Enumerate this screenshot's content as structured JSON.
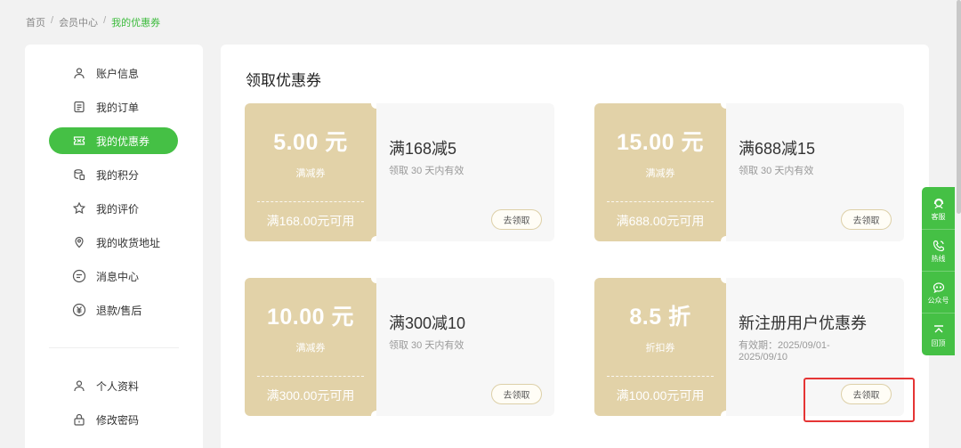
{
  "breadcrumb": {
    "home": "首页",
    "member": "会员中心",
    "current": "我的优惠券",
    "sep": "/"
  },
  "sidebar": {
    "items": [
      {
        "label": "账户信息",
        "icon": "user-icon"
      },
      {
        "label": "我的订单",
        "icon": "order-icon"
      },
      {
        "label": "我的优惠券",
        "icon": "coupon-icon",
        "active": true
      },
      {
        "label": "我的积分",
        "icon": "points-icon"
      },
      {
        "label": "我的评价",
        "icon": "review-icon"
      },
      {
        "label": "我的收货地址",
        "icon": "location-icon"
      },
      {
        "label": "消息中心",
        "icon": "message-icon"
      },
      {
        "label": "退款/售后",
        "icon": "refund-icon"
      },
      {
        "label": "个人资料",
        "icon": "profile-icon"
      },
      {
        "label": "修改密码",
        "icon": "lock-icon"
      }
    ]
  },
  "main": {
    "title": "领取优惠券",
    "coupons": [
      {
        "amount": "5.00 元",
        "kind": "满减券",
        "condition": "满168.00元可用",
        "name": "满168减5",
        "validity": "领取 30 天内有效",
        "button": "去领取"
      },
      {
        "amount": "15.00 元",
        "kind": "满减券",
        "condition": "满688.00元可用",
        "name": "满688减15",
        "validity": "领取 30 天内有效",
        "button": "去领取"
      },
      {
        "amount": "10.00 元",
        "kind": "满减券",
        "condition": "满300.00元可用",
        "name": "满300减10",
        "validity": "领取 30 天内有效",
        "button": "去领取"
      },
      {
        "amount": "8.5 折",
        "kind": "折扣券",
        "condition": "满100.00元可用",
        "name": "新注册用户优惠券",
        "validity": "有效期：2025/09/01-2025/09/10",
        "button": "去领取"
      }
    ]
  },
  "float_bar": {
    "items": [
      {
        "label": "客服",
        "icon": "customer-service-icon"
      },
      {
        "label": "热线",
        "icon": "phone-icon"
      },
      {
        "label": "公众号",
        "icon": "wechat-icon"
      },
      {
        "label": "回顶",
        "icon": "back-to-top-icon"
      }
    ]
  },
  "colors": {
    "accent": "#45c045",
    "coupon_gold": "#e2d2a8",
    "highlight": "#e53535"
  }
}
